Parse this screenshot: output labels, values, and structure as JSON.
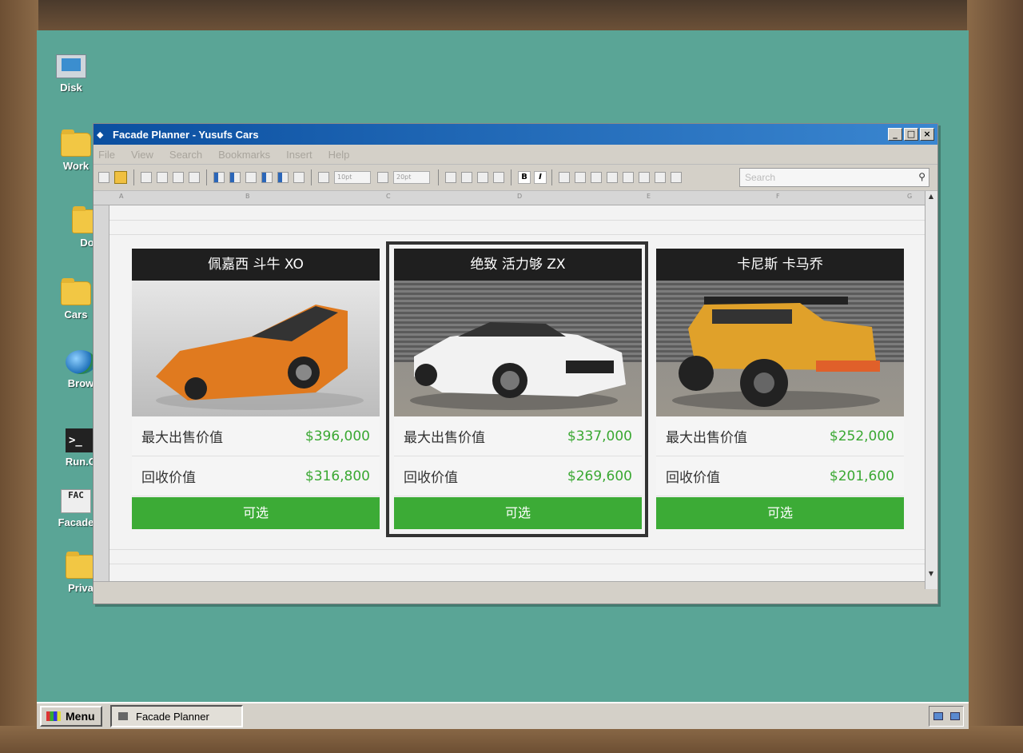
{
  "desktop": {
    "icons": [
      {
        "label": "Disk",
        "icon": "computer-icon"
      },
      {
        "label": "Work",
        "icon": "folder-icon"
      },
      {
        "label": "Do",
        "icon": "folder-icon"
      },
      {
        "label": "Cars",
        "icon": "folder-icon"
      },
      {
        "label": "Brow",
        "icon": "globe-icon"
      },
      {
        "label": "Run.C",
        "icon": "terminal-icon",
        "glyph": ">_"
      },
      {
        "label": "Facade",
        "icon": "facade-app-icon",
        "glyph": "FAC"
      },
      {
        "label": "Priva",
        "icon": "folder-icon"
      }
    ]
  },
  "window": {
    "title": "Facade Planner - Yusufs Cars",
    "controls": {
      "minimize": "_",
      "maximize": "□",
      "close": "×"
    },
    "menu": [
      "File",
      "View",
      "Search",
      "Bookmarks",
      "Insert",
      "Help"
    ],
    "toolbar": {
      "font_size_1": "10pt",
      "font_size_2": "20pt",
      "bold": "B",
      "italic": "I",
      "search_placeholder": "Search"
    },
    "columns": [
      "A",
      "B",
      "C",
      "D",
      "E",
      "F",
      "G"
    ]
  },
  "cards": [
    {
      "name": "佩嘉西 斗牛 XO",
      "max_sale_label": "最大出售价值",
      "max_sale_value": "$396,000",
      "trade_label": "回收价值",
      "trade_value": "$316,800",
      "status": "可选",
      "car_color": "#e07a1f"
    },
    {
      "name": "绝致 活力够 ZX",
      "max_sale_label": "最大出售价值",
      "max_sale_value": "$337,000",
      "trade_label": "回收价值",
      "trade_value": "$269,600",
      "status": "可选",
      "car_color": "#f2f2f2"
    },
    {
      "name": "卡尼斯 卡马乔",
      "max_sale_label": "最大出售价值",
      "max_sale_value": "$252,000",
      "trade_label": "回收价值",
      "trade_value": "$201,600",
      "status": "可选",
      "car_color": "#e0a12a"
    }
  ],
  "taskbar": {
    "menu_label": "Menu",
    "task_label": "Facade Planner"
  },
  "colors": {
    "desktop": "#5aa596",
    "accent_green": "#3cab36",
    "price_green": "#3aa832",
    "title_bar": "#0b4fa0"
  }
}
